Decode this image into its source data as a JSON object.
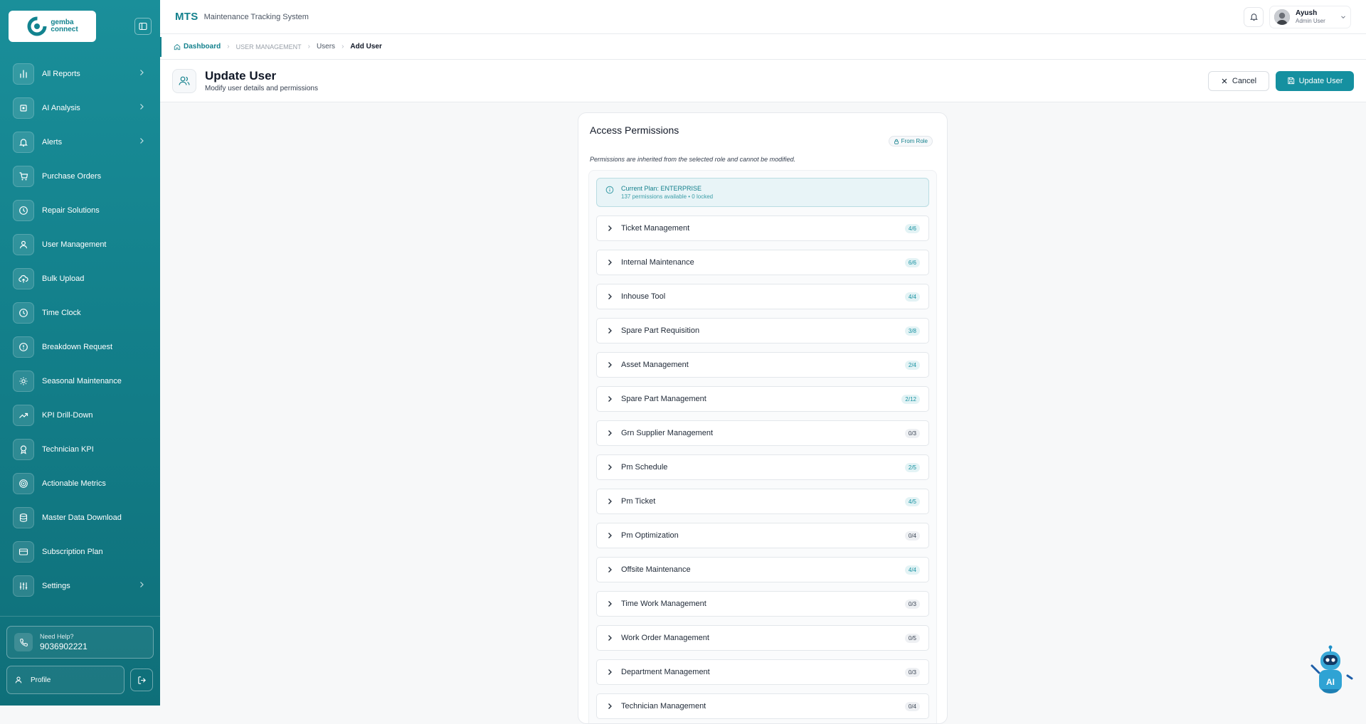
{
  "sidebar": {
    "logo": {
      "line1": "gemba",
      "line2": "connect"
    },
    "items": [
      {
        "label": "All Reports",
        "icon": "bar-chart-icon",
        "expandable": true
      },
      {
        "label": "AI Analysis",
        "icon": "cpu-icon",
        "expandable": true
      },
      {
        "label": "Alerts",
        "icon": "bell-icon",
        "expandable": true
      },
      {
        "label": "Purchase Orders",
        "icon": "cart-icon",
        "expandable": false
      },
      {
        "label": "Repair Solutions",
        "icon": "clock-icon",
        "expandable": false
      },
      {
        "label": "User Management",
        "icon": "users-icon",
        "expandable": false
      },
      {
        "label": "Bulk Upload",
        "icon": "cloud-upload-icon",
        "expandable": false
      },
      {
        "label": "Time Clock",
        "icon": "clock-icon",
        "expandable": false
      },
      {
        "label": "Breakdown Request",
        "icon": "alert-circle-icon",
        "expandable": false
      },
      {
        "label": "Seasonal Maintenance",
        "icon": "sun-icon",
        "expandable": false
      },
      {
        "label": "KPI Drill-Down",
        "icon": "trending-up-icon",
        "expandable": false
      },
      {
        "label": "Technician KPI",
        "icon": "award-icon",
        "expandable": false
      },
      {
        "label": "Actionable Metrics",
        "icon": "target-icon",
        "expandable": false
      },
      {
        "label": "Master Data Download",
        "icon": "database-icon",
        "expandable": false
      },
      {
        "label": "Subscription Plan",
        "icon": "credit-card-icon",
        "expandable": false
      },
      {
        "label": "Settings",
        "icon": "sliders-icon",
        "expandable": true
      }
    ],
    "help": {
      "label": "Need Help?",
      "phone": "9036902221"
    },
    "profile_label": "Profile"
  },
  "header": {
    "brand": "MTS",
    "subtitle": "Maintenance Tracking System",
    "user": {
      "name": "Ayush",
      "role": "Admin User"
    }
  },
  "breadcrumb": [
    "Dashboard",
    "USER MANAGEMENT",
    "Users",
    "Add User"
  ],
  "page": {
    "title": "Update User",
    "subtitle": "Modify user details and permissions",
    "cancel_label": "Cancel",
    "update_label": "Update User"
  },
  "permissions": {
    "title": "Access Permissions",
    "badge": "From Role",
    "note": "Permissions are inherited from the selected role and cannot be modified.",
    "plan_title": "Current Plan: ENTERPRISE",
    "plan_sub": "137 permissions available • 0 locked",
    "groups": [
      {
        "name": "Ticket Management",
        "count": "4/6"
      },
      {
        "name": "Internal Maintenance",
        "count": "6/6"
      },
      {
        "name": "Inhouse Tool",
        "count": "4/4"
      },
      {
        "name": "Spare Part Requisition",
        "count": "3/8"
      },
      {
        "name": "Asset Management",
        "count": "2/4"
      },
      {
        "name": "Spare Part Management",
        "count": "2/12"
      },
      {
        "name": "Grn Supplier Management",
        "count": "0/3"
      },
      {
        "name": "Pm Schedule",
        "count": "2/5"
      },
      {
        "name": "Pm Ticket",
        "count": "4/5"
      },
      {
        "name": "Pm Optimization",
        "count": "0/4"
      },
      {
        "name": "Offsite Maintenance",
        "count": "4/4"
      },
      {
        "name": "Time Work Management",
        "count": "0/3"
      },
      {
        "name": "Work Order Management",
        "count": "0/5"
      },
      {
        "name": "Department Management",
        "count": "0/3"
      },
      {
        "name": "Technician Management",
        "count": "0/4"
      }
    ]
  },
  "assistant": {
    "label": "AI"
  },
  "colors": {
    "primary": "#1590a0",
    "sidebar": "#13808b",
    "accent_text": "#14818d"
  }
}
